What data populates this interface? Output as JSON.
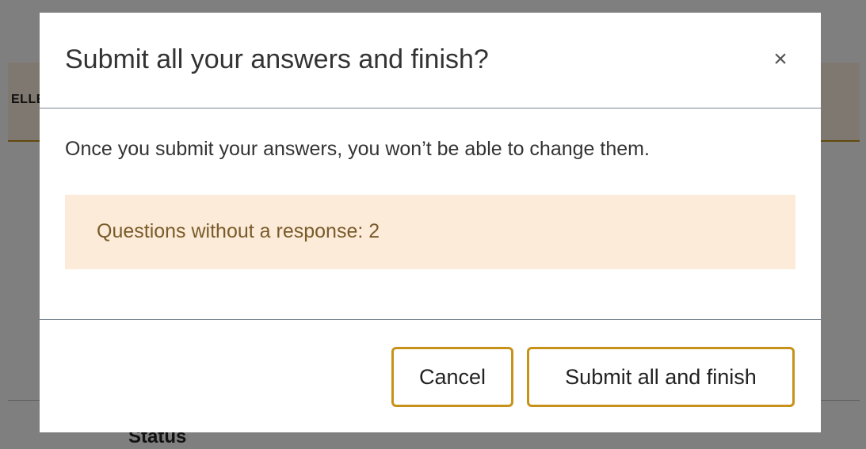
{
  "page": {
    "header_text": "ELLE",
    "status_label": "Status"
  },
  "modal": {
    "title": "Submit all your answers and finish?",
    "close_symbol": "×",
    "body_text": "Once you submit your answers, you won’t be able to change them.",
    "notice_text": "Questions without a response: 2",
    "cancel_label": "Cancel",
    "submit_label": "Submit all and finish"
  },
  "colors": {
    "accent_border": "#c6921a",
    "notice_background": "#fcebd9",
    "notice_text": "#7a5b2a",
    "overlay": "rgba(0,0,0,0.5)"
  }
}
